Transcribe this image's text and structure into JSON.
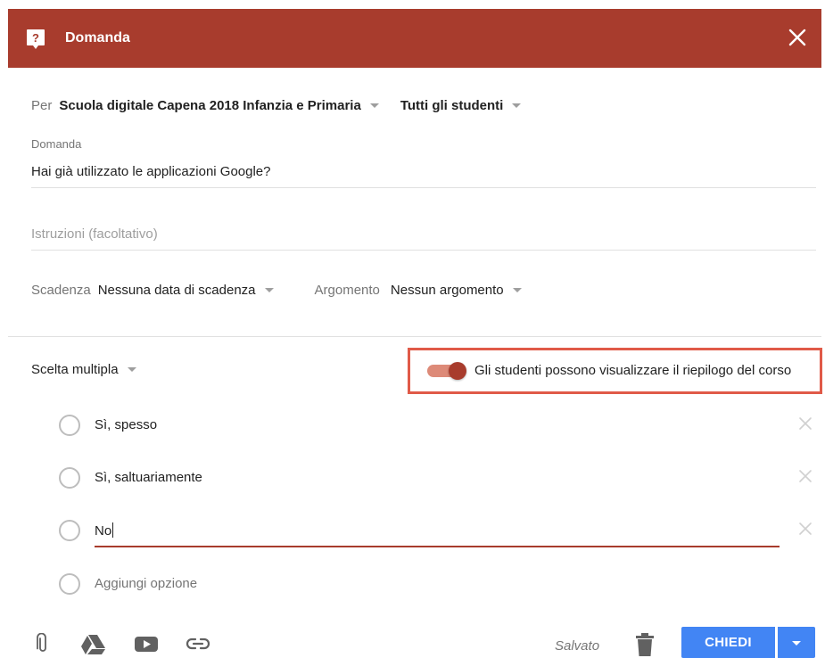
{
  "header": {
    "title": "Domanda",
    "color": "#a83c2d"
  },
  "audience": {
    "per_label": "Per",
    "class_name": "Scuola digitale Capena 2018 Infanzia e Primaria",
    "students": "Tutti gli studenti"
  },
  "question": {
    "label": "Domanda",
    "value": "Hai già utilizzato le applicazioni Google?"
  },
  "instructions": {
    "placeholder": "Istruzioni (facoltativo)"
  },
  "meta": {
    "due_label": "Scadenza",
    "due_value": "Nessuna data di scadenza",
    "topic_label": "Argomento",
    "topic_value": "Nessun argomento"
  },
  "answer_type": "Scelta multipla",
  "summary_toggle": {
    "label": "Gli studenti possono visualizzare il riepilogo del corso",
    "on": true
  },
  "options": [
    {
      "text": "Sì, spesso"
    },
    {
      "text": "Sì, saltuariamente"
    },
    {
      "text": "No"
    }
  ],
  "add_option": "Aggiungi opzione",
  "footer": {
    "icons": [
      "paperclip-icon",
      "google-drive-icon",
      "youtube-icon",
      "link-icon"
    ],
    "saved": "Salvato",
    "ask_button": "CHIEDI",
    "accent": "#4285f4"
  }
}
